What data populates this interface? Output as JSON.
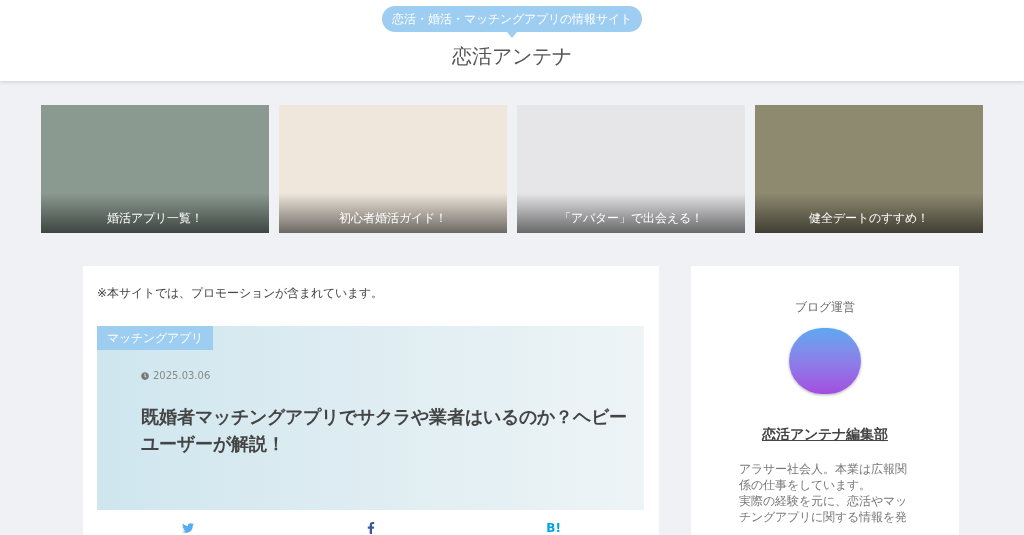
{
  "header": {
    "tagline": "恋活・婚活・マッチングアプリの情報サイト",
    "site_title": "恋活アンテナ"
  },
  "featured": [
    {
      "caption": "婚活アプリ一覧！",
      "color": "#8a9a90"
    },
    {
      "caption": "初心者婚活ガイド！",
      "color": "#efe7dc"
    },
    {
      "caption": "「アバター」で出会える！",
      "color": "#e6e6e8"
    },
    {
      "caption": "健全デートのすすめ！",
      "color": "#8e8a70"
    }
  ],
  "main": {
    "notice": "※本サイトでは、プロモーションが含まれています。",
    "article": {
      "category": "マッチングアプリ",
      "date": "2025.03.06",
      "title": "既婚者マッチングアプリでサクラや業者はいるのか？ヘビーユーザーが解説！"
    },
    "share": [
      {
        "kind": "twitter"
      },
      {
        "kind": "facebook"
      },
      {
        "kind": "hatena",
        "label": "B!"
      }
    ]
  },
  "sidebar": {
    "heading": "ブログ運営",
    "name": "恋活アンテナ編集部",
    "bio": [
      "アラサー社会人。本業は広報関係の仕事をしています。",
      "実際の経験を元に、恋活やマッチングアプリに関する情報を発"
    ]
  }
}
